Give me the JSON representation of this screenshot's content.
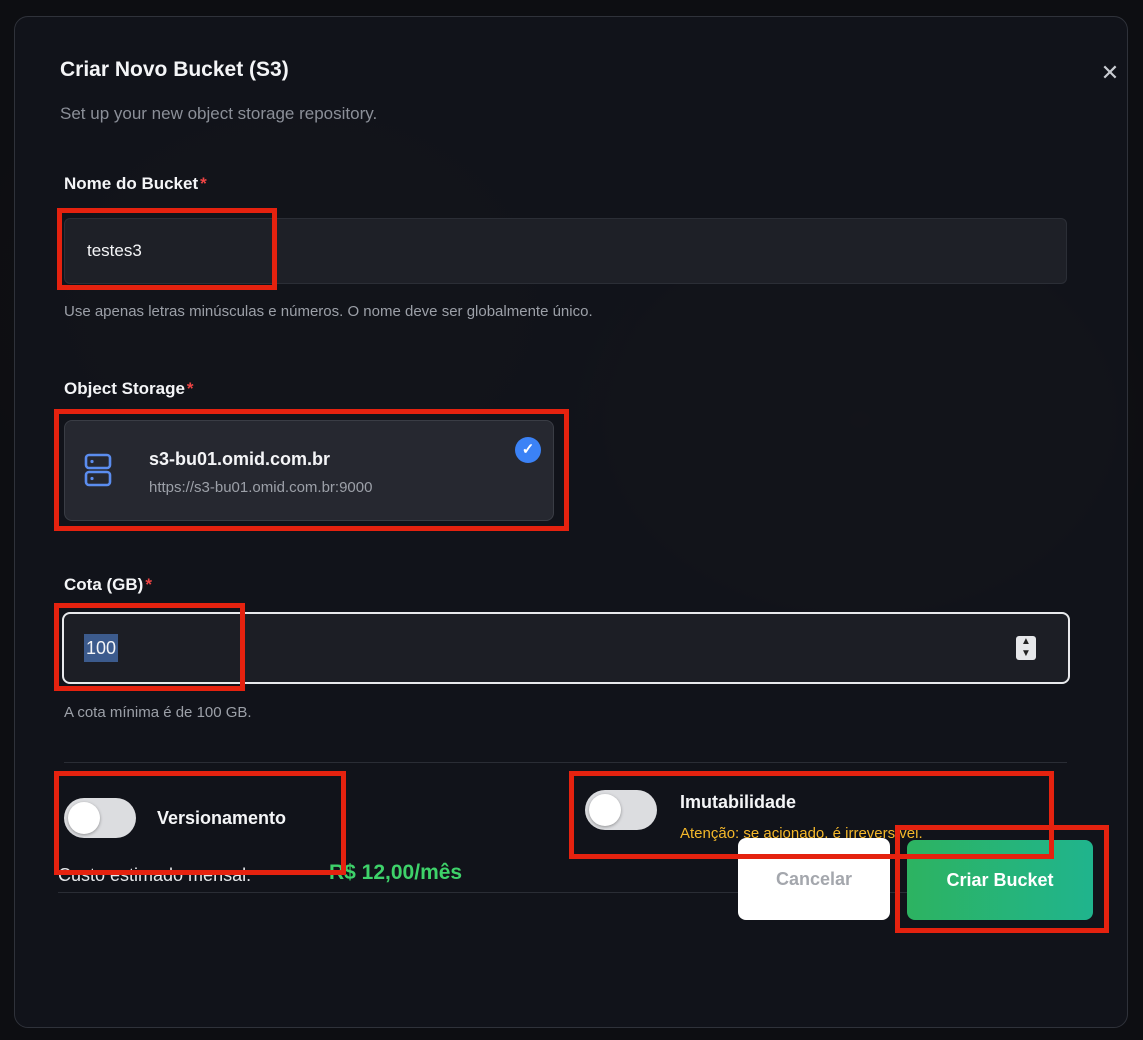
{
  "dialog": {
    "title": "Criar Novo Bucket (S3)",
    "subtitle": "Set up your new object storage repository.",
    "close_icon": "close-icon"
  },
  "bucket_name": {
    "label": "Nome do Bucket",
    "required_mark": "*",
    "value": "testes3",
    "help": "Use apenas letras minúsculas e números. O nome deve ser globalmente único."
  },
  "object_storage": {
    "label": "Object Storage",
    "required_mark": "*",
    "selected": {
      "icon": "server-icon",
      "name": "s3-bu01.omid.com.br",
      "url": "https://s3-bu01.omid.com.br:9000",
      "checked_icon": "check-circle-icon"
    }
  },
  "quota": {
    "label": "Cota (GB)",
    "required_mark": "*",
    "value": "100",
    "help": "A cota mínima é de 100 GB.",
    "stepper_icon": "stepper-arrows-icon"
  },
  "versioning": {
    "label": "Versionamento",
    "enabled": false
  },
  "immutability": {
    "label": "Imutabilidade",
    "warning": "Atenção: se acionado, é irreversível.",
    "enabled": false
  },
  "footer": {
    "cost_label": "Custo estimado mensal:",
    "cost_value": "R$ 12,00/mês",
    "cancel_label": "Cancelar",
    "create_label": "Criar Bucket"
  },
  "colors": {
    "accent_green": "#3ed26a",
    "warning_yellow": "#f5b82a",
    "required_red": "#ef4444",
    "check_blue": "#3b82f6",
    "highlight_red": "#e5220f"
  }
}
